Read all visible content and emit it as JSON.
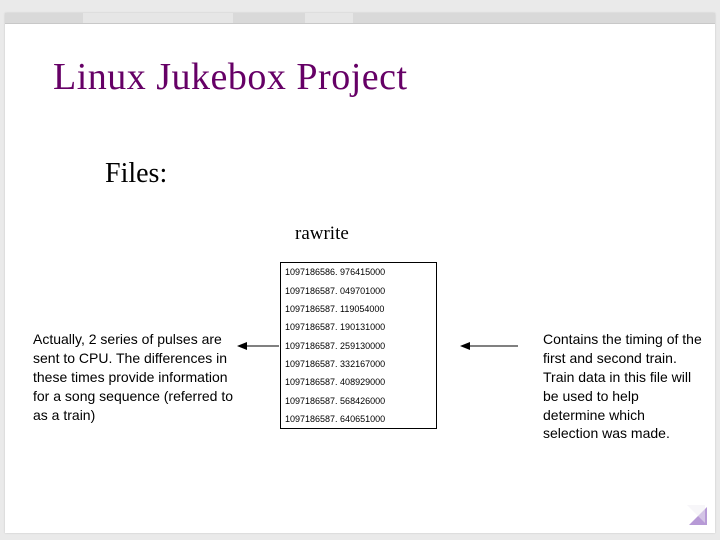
{
  "title": "Linux Jukebox Project",
  "subtitle": "Files:",
  "fileLabel": "rawrite",
  "timestamps": [
    "1097186586. 976415000",
    "1097186587. 049701000",
    "1097186587. 119054000",
    "1097186587. 190131000",
    "1097186587. 259130000",
    "1097186587. 332167000",
    "1097186587. 408929000",
    "1097186587. 568426000",
    "1097186587. 640651000"
  ],
  "annotLeft": "Actually, 2 series of pulses are sent to CPU. The differences in these times provide information for a song sequence (referred to as a train)",
  "annotRight": "Contains the timing of the first and second train. Train data in this file will be used to help determine which selection was made."
}
